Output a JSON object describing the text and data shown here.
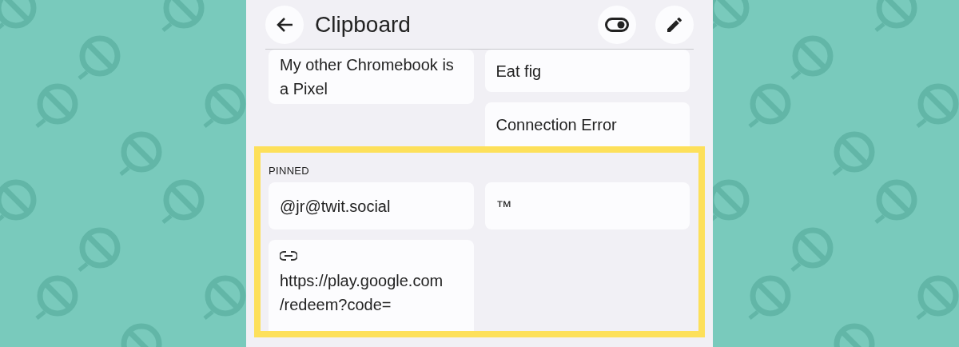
{
  "header": {
    "title": "Clipboard"
  },
  "recent": [
    [
      {
        "kind": "text",
        "lines": [
          "My other Chromebook is",
          "a Pixel"
        ]
      }
    ],
    [
      {
        "kind": "text",
        "lines": [
          "Eat fig"
        ]
      },
      {
        "kind": "text",
        "lines": [
          "Connection Error"
        ]
      }
    ]
  ],
  "pinned": {
    "label": "PINNED",
    "columns": [
      [
        {
          "kind": "text",
          "lines": [
            "@jr@twit.social"
          ]
        },
        {
          "kind": "link",
          "lines": [
            "https://play.google.com",
            "/redeem?code="
          ]
        }
      ],
      [
        {
          "kind": "text",
          "lines": [
            "™"
          ]
        }
      ]
    ]
  }
}
